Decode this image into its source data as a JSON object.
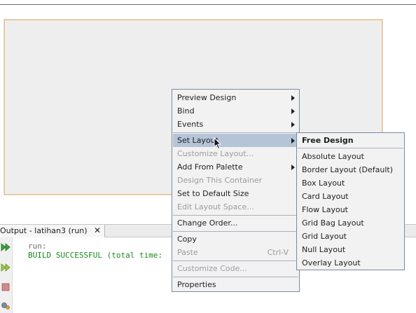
{
  "output": {
    "tab_label": "Output - latihan3 (run)",
    "tab_close": "✕",
    "line1": "run:",
    "line2": "BUILD SUCCESSFUL (total time:"
  },
  "context_menu": {
    "items": [
      {
        "label": "Preview Design",
        "submenu": true,
        "enabled": true
      },
      {
        "label": "Bind",
        "submenu": true,
        "enabled": true
      },
      {
        "label": "Events",
        "submenu": true,
        "enabled": true
      },
      {
        "label": "Set Layout",
        "submenu": true,
        "enabled": true,
        "highlighted": true
      },
      {
        "label": "Customize Layout...",
        "submenu": false,
        "enabled": false
      },
      {
        "label": "Add From Palette",
        "submenu": true,
        "enabled": true
      },
      {
        "label": "Design This Container",
        "submenu": false,
        "enabled": false
      },
      {
        "label": "Set to Default Size",
        "submenu": false,
        "enabled": true
      },
      {
        "label": "Edit Layout Space...",
        "submenu": false,
        "enabled": false
      },
      {
        "label": "Change Order...",
        "submenu": false,
        "enabled": true
      },
      {
        "label": "Copy",
        "submenu": false,
        "enabled": true
      },
      {
        "label": "Paste",
        "submenu": false,
        "enabled": false,
        "shortcut": "Ctrl-V"
      },
      {
        "label": "Customize Code...",
        "submenu": false,
        "enabled": false
      },
      {
        "label": "Properties",
        "submenu": false,
        "enabled": true
      }
    ]
  },
  "layout_submenu": {
    "items": [
      {
        "label": "Free Design",
        "bold": true
      },
      {
        "label": "Absolute Layout"
      },
      {
        "label": "Border Layout (Default)"
      },
      {
        "label": "Box Layout"
      },
      {
        "label": "Card Layout"
      },
      {
        "label": "Flow Layout"
      },
      {
        "label": "Grid Bag Layout"
      },
      {
        "label": "Grid Layout"
      },
      {
        "label": "Null Layout"
      },
      {
        "label": "Overlay Layout"
      }
    ]
  },
  "colors": {
    "highlight": "#b6c4d8",
    "menu_bg": "#f2f2f2",
    "success_text": "#1a8a1a",
    "form_border": "#f0c080"
  }
}
